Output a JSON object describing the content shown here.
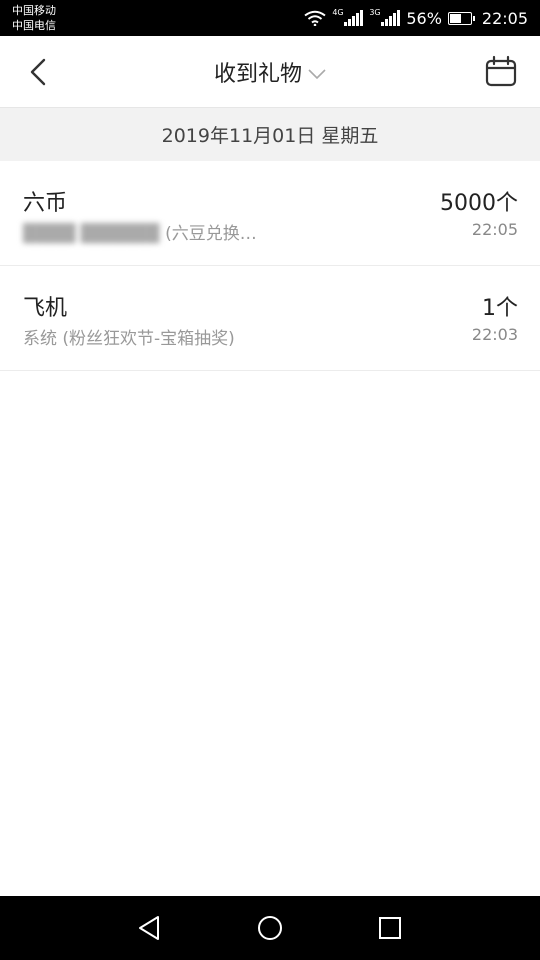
{
  "status_bar": {
    "carrier_1": "中国移动",
    "carrier_2": "中国电信",
    "sim1_network": "4G",
    "sim2_network": "3G",
    "battery_percent": "56%",
    "battery_level": 0.56,
    "time": "22:05",
    "icons": [
      "wifi-icon",
      "signal-icon",
      "signal-icon",
      "battery-icon"
    ]
  },
  "header": {
    "back_icon": "back-arrow-icon",
    "title": "收到礼物",
    "dropdown_icon": "chevron-down-icon",
    "calendar_icon": "calendar-icon"
  },
  "date_bar": {
    "date": "2019年11月01日 星期五"
  },
  "gifts": [
    {
      "name": "六币",
      "count": "5000个",
      "source_blurred": "████ ██████",
      "source": "(六豆兑换…",
      "time": "22:05"
    },
    {
      "name": "飞机",
      "count": "1个",
      "source": "系统 (粉丝狂欢节-宝箱抽奖)",
      "time": "22:03"
    }
  ],
  "nav_bar": {
    "icons": [
      "nav-back-icon",
      "nav-home-icon",
      "nav-recent-icon"
    ]
  },
  "colors": {
    "status_bar_bg": "#000000",
    "date_bar_bg": "#f2f2f2",
    "primary_text": "#222222",
    "secondary_text": "#999999"
  }
}
